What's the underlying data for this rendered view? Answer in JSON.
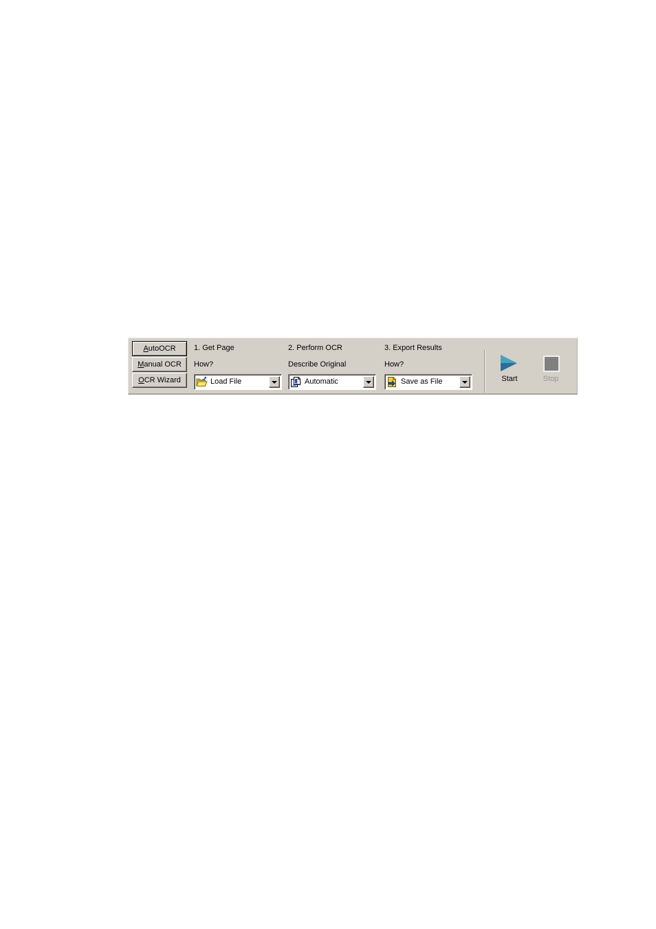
{
  "toolbar": {
    "mode_buttons": [
      {
        "name": "auto-ocr",
        "label_pre": "",
        "accel": "A",
        "label_post": "utoOCR",
        "default": true
      },
      {
        "name": "manual-ocr",
        "label_pre": "",
        "accel": "M",
        "label_post": "anual OCR",
        "default": false
      },
      {
        "name": "ocr-wizard",
        "label_pre": "",
        "accel": "O",
        "label_post": "CR Wizard",
        "default": false
      }
    ],
    "steps": [
      {
        "title": "1. Get Page",
        "sub": "How?",
        "combo_value": "Load File",
        "icon": "open-folder-icon"
      },
      {
        "title": "2.  Perform OCR",
        "sub": "Describe Original",
        "combo_value": "Automatic",
        "icon": "document-pages-icon"
      },
      {
        "title": "3.  Export Results",
        "sub": "How?",
        "combo_value": "Save as File",
        "icon": "save-file-icon"
      }
    ],
    "actions": {
      "start": {
        "label": "Start",
        "icon": "play-triangle-icon",
        "enabled": true
      },
      "stop": {
        "label": "Stop",
        "icon": "stop-square-icon",
        "enabled": false
      }
    },
    "colors": {
      "panel_face": "#d4d0c8",
      "play_teal": "#45a3bd",
      "stop_gray": "#808080",
      "disabled_text": "#9a968f"
    }
  }
}
